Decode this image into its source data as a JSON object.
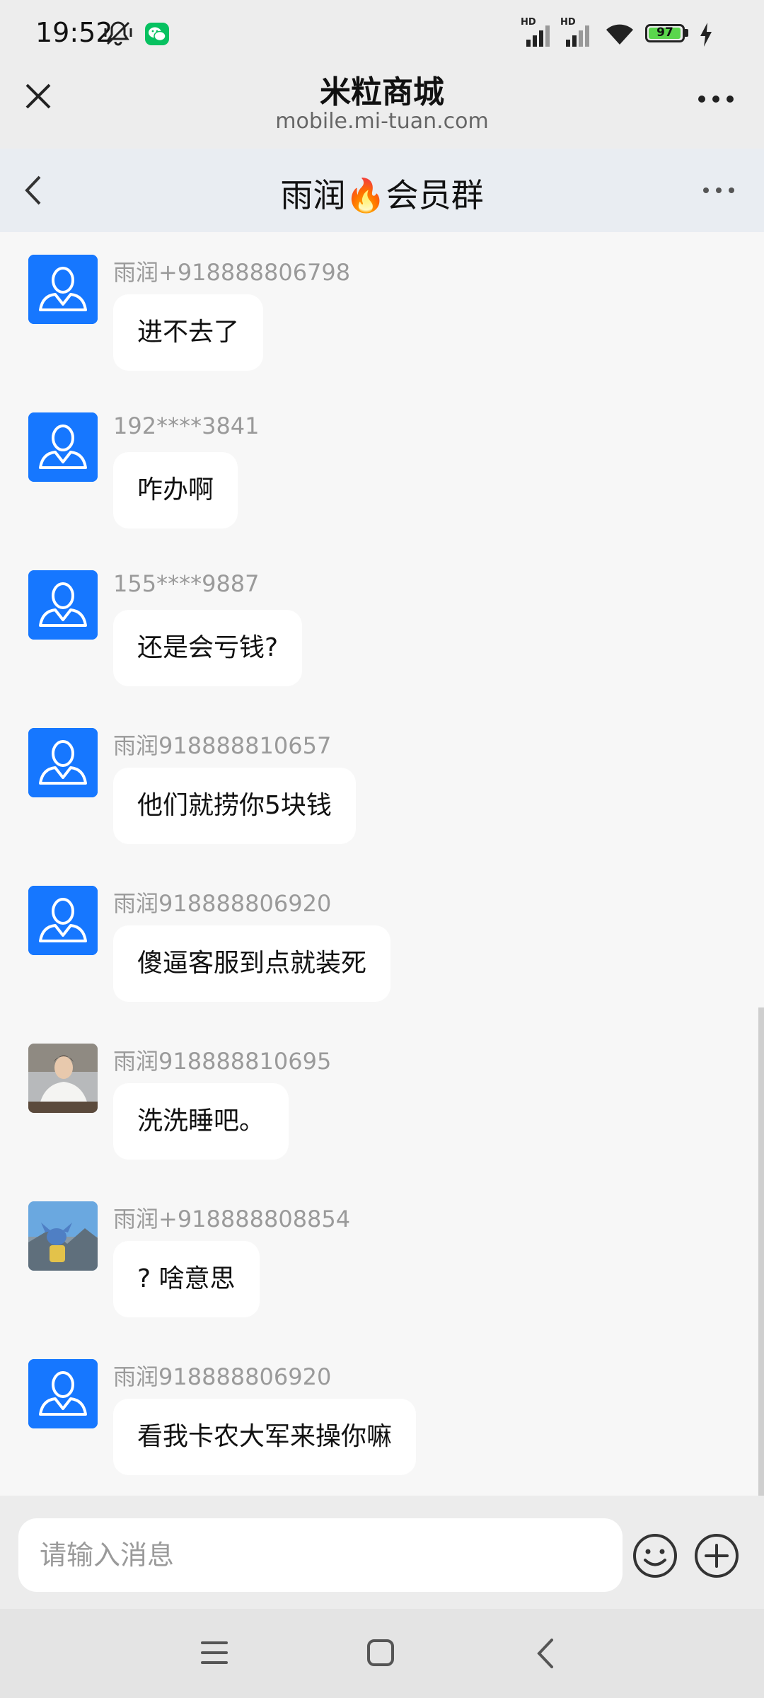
{
  "status_bar": {
    "time": "19:52",
    "battery": "97",
    "battery_level": 0.97,
    "signal_labels": [
      "HD",
      "HD"
    ],
    "icons": [
      "mute-vibrate-icon",
      "wechat-icon",
      "signal-icon",
      "signal-icon",
      "wifi-icon",
      "battery-icon",
      "charging-icon"
    ]
  },
  "browser": {
    "title": "米粒商城",
    "url": "mobile.mi-tuan.com"
  },
  "chat": {
    "title": "雨润🔥会员群"
  },
  "messages": [
    {
      "sender": "雨润+918888806798",
      "text": "进不去了",
      "avatar": "default-user-icon"
    },
    {
      "sender": "192****3841",
      "text": "咋办啊",
      "avatar": "default-user-icon"
    },
    {
      "sender": "155****9887",
      "text": "还是会亏钱?",
      "avatar": "default-user-icon"
    },
    {
      "sender": "雨润918888810657",
      "text": "他们就捞你5块钱",
      "avatar": "default-user-icon"
    },
    {
      "sender": "雨润918888806920",
      "text": "傻逼客服到点就装死",
      "avatar": "default-user-icon"
    },
    {
      "sender": "雨润918888810695",
      "text": "洗洗睡吧。",
      "avatar": "photo-man-white-shirt"
    },
    {
      "sender": "雨润+918888808854",
      "text": "? 啥意思",
      "avatar": "photo-stitch-figure-mountain"
    },
    {
      "sender": "雨润918888806920",
      "text": "看我卡农大军来操你嘛",
      "avatar": "default-user-icon"
    }
  ],
  "composer": {
    "placeholder": "请输入消息"
  },
  "colors": {
    "accent": "#1677ff",
    "header_bg": "#ededed",
    "chat_header_bg": "#e9edf2",
    "chat_bg": "#f7f7f7",
    "bubble_bg": "#ffffff",
    "wechat_green": "#07c160",
    "battery_green": "#5ad64c"
  }
}
